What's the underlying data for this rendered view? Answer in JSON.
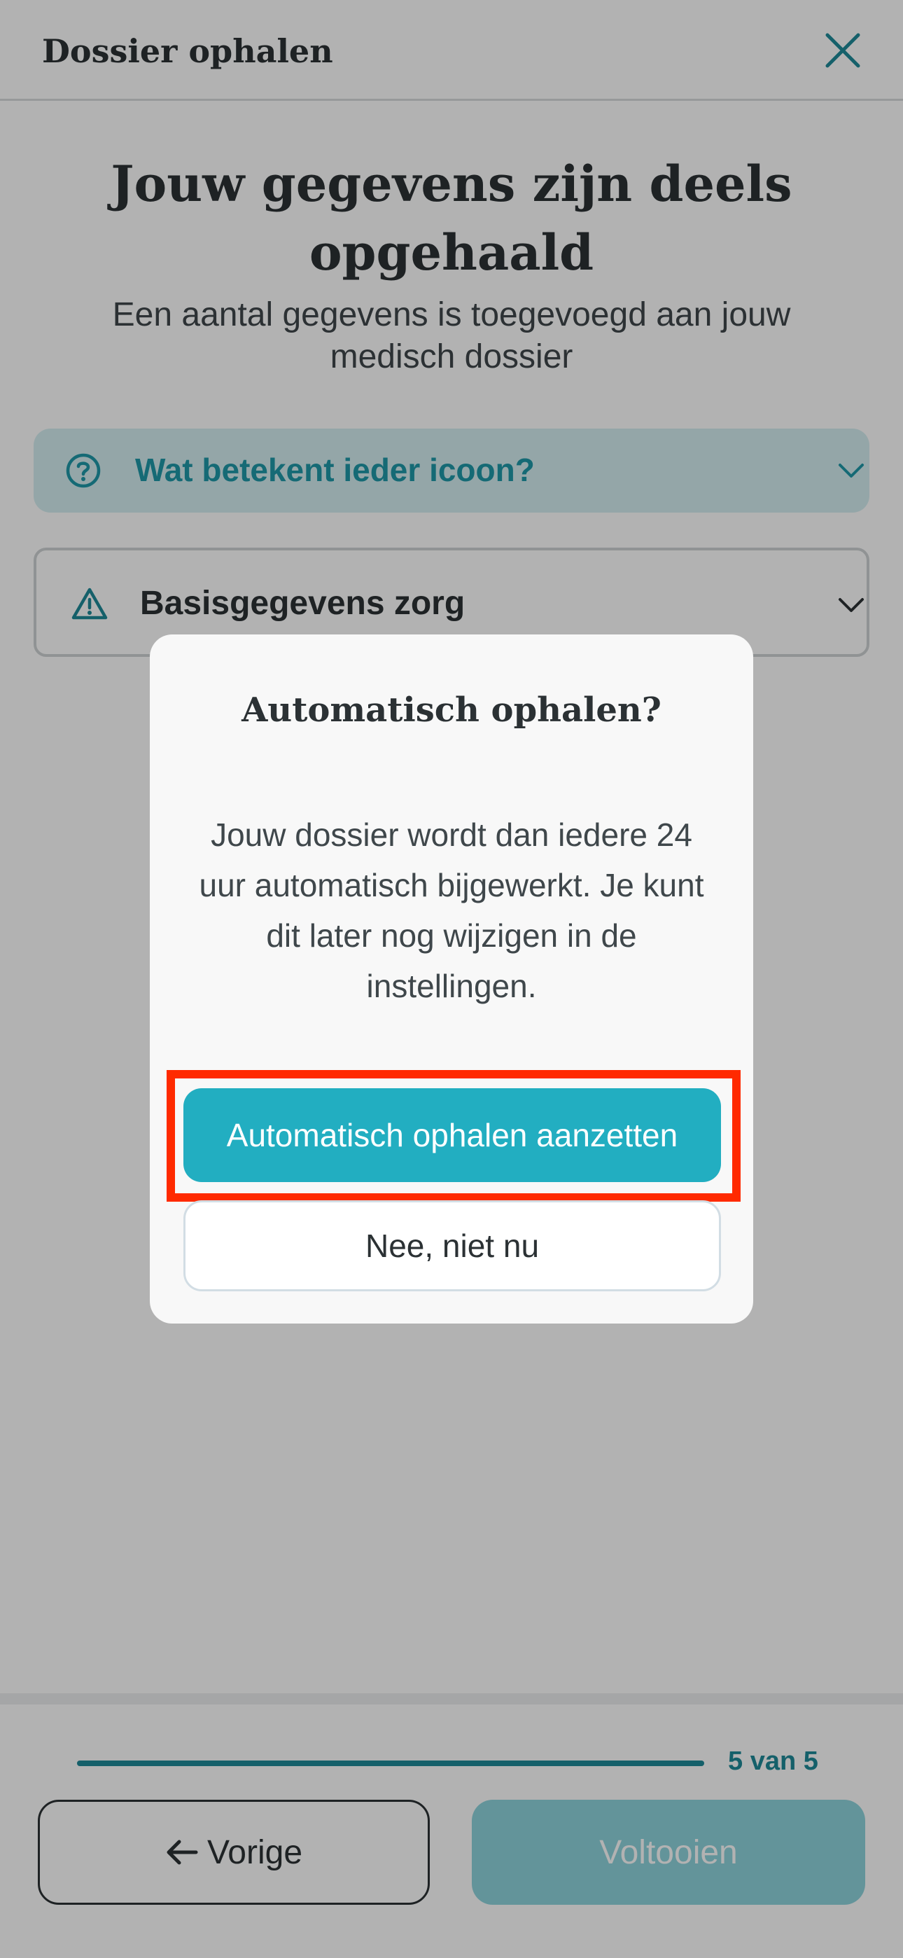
{
  "header": {
    "title": "Dossier ophalen"
  },
  "hero": {
    "title": "Jouw gegevens zijn deels opgehaald",
    "subtitle": "Een aantal gegevens is toegevoegd aan jouw medisch dossier"
  },
  "accordions": {
    "help_label": "Wat betekent ieder icoon?",
    "basis_label": "Basisgegevens zorg"
  },
  "modal": {
    "title": "Automatisch ophalen?",
    "body": "Jouw dossier wordt dan iedere 24 uur automatisch bijgewerkt. Je kunt dit later nog wijzigen in de instellingen.",
    "primary_label": "Automatisch ophalen aanzetten",
    "secondary_label": "Nee, niet nu"
  },
  "footer": {
    "progress_text": "5 van 5",
    "progress_fraction": 1.0,
    "prev_label": "Vorige",
    "done_label": "Voltooien"
  },
  "colors": {
    "accent": "#22aec1",
    "accent_dark": "#1f8a98",
    "highlight": "#ff2a00",
    "text": "#2b3134"
  },
  "icons": {
    "close": "close-icon",
    "help": "question-circle-icon",
    "warning": "warning-triangle-icon",
    "chevron": "chevron-down-icon",
    "back": "arrow-left-icon"
  }
}
